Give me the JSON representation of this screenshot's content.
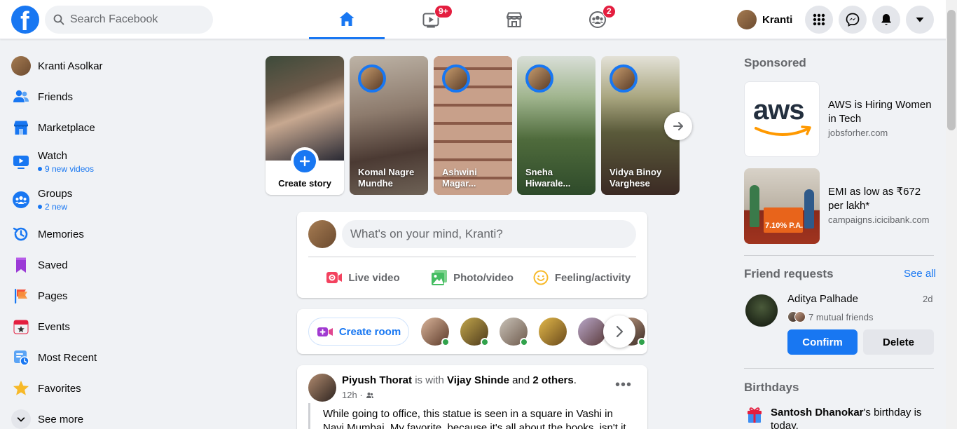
{
  "topbar": {
    "logo": "f",
    "search_placeholder": "Search Facebook",
    "tabs": [
      {
        "name": "home",
        "icon": "home-icon",
        "active": true
      },
      {
        "name": "watch",
        "icon": "video-icon",
        "badge": "9+"
      },
      {
        "name": "marketplace",
        "icon": "store-icon"
      },
      {
        "name": "groups",
        "icon": "groups-icon",
        "badge": "2"
      }
    ],
    "profile_name": "Kranti"
  },
  "left_sidebar": {
    "items": [
      {
        "label": "Kranti Asolkar",
        "icon": "profile-avatar"
      },
      {
        "label": "Friends",
        "icon": "friends-icon"
      },
      {
        "label": "Marketplace",
        "icon": "marketplace-icon"
      },
      {
        "label": "Watch",
        "icon": "watch-icon",
        "sub": "9 new videos"
      },
      {
        "label": "Groups",
        "icon": "groups-icon",
        "sub": "2 new"
      },
      {
        "label": "Memories",
        "icon": "memories-icon"
      },
      {
        "label": "Saved",
        "icon": "saved-icon"
      },
      {
        "label": "Pages",
        "icon": "pages-icon"
      },
      {
        "label": "Events",
        "icon": "events-icon"
      },
      {
        "label": "Most Recent",
        "icon": "most-recent-icon"
      },
      {
        "label": "Favorites",
        "icon": "favorites-icon"
      },
      {
        "label": "See more",
        "icon": "chevron-down-icon"
      }
    ]
  },
  "stories": {
    "create_label": "Create story",
    "items": [
      {
        "name": "Komal Nagre Mundhe"
      },
      {
        "name": "Ashwini Magar..."
      },
      {
        "name": "Sneha Hiwarale..."
      },
      {
        "name": "Vidya Binoy Varghese"
      }
    ]
  },
  "composer": {
    "placeholder": "What's on your mind, Kranti?",
    "actions": [
      {
        "label": "Live video",
        "icon": "live-video-icon",
        "color": "#f3425f"
      },
      {
        "label": "Photo/video",
        "icon": "photo-icon",
        "color": "#45bd62"
      },
      {
        "label": "Feeling/activity",
        "icon": "feeling-icon",
        "color": "#f7b928"
      }
    ]
  },
  "rooms": {
    "create_label": "Create room"
  },
  "post": {
    "author": "Piyush Thorat",
    "with_text": "is with",
    "tagged": "Vijay Shinde",
    "and_text": "and",
    "others": "2 others",
    "time": "12h",
    "body": "While going to office, this statue is seen in a square in Vashi in Navi Mumbai. My favorite, because it's all about the books, isn't it the"
  },
  "right_sidebar": {
    "sponsored_heading": "Sponsored",
    "ads": [
      {
        "title": "AWS is Hiring Women in Tech",
        "domain": "jobsforher.com",
        "logo_text": "aws"
      },
      {
        "title": "EMI as low as ₹672 per lakh*",
        "domain": "campaigns.icicibank.com",
        "banner_text": "7.10% P.A."
      }
    ],
    "friend_requests": {
      "heading": "Friend requests",
      "see_all": "See all",
      "name": "Aditya Palhade",
      "time": "2d",
      "mutual": "7 mutual friends",
      "confirm": "Confirm",
      "delete": "Delete"
    },
    "birthdays": {
      "heading": "Birthdays",
      "name": "Santosh Dhanokar",
      "text": "'s birthday is today."
    }
  },
  "colors": {
    "brand": "#1877f2",
    "badge": "#e41e3f",
    "online": "#31a24c"
  }
}
